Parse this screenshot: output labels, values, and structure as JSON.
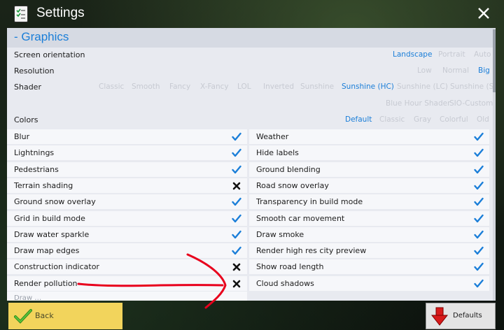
{
  "window": {
    "title": "Settings"
  },
  "section": {
    "title": "- Graphics"
  },
  "settings": [
    {
      "label": "Screen orientation",
      "options": [
        "Landscape",
        "Portrait",
        "Auto"
      ],
      "selected": "Landscape"
    },
    {
      "label": "Resolution",
      "options": [
        "Low",
        "Normal",
        "Big"
      ],
      "selected": "Big"
    },
    {
      "label": "Shader",
      "options": [
        "Classic",
        "Smooth",
        "Fancy",
        "X-Fancy",
        "LOL",
        "Inverted",
        "Sunshine",
        "Sunshine (HC)",
        "Sunshine (LC)",
        "Sunshine (S)",
        "Blue Hour Shader",
        "SIO-Custom"
      ],
      "selected": "Sunshine (HC)"
    },
    {
      "label": "Colors",
      "options": [
        "Default",
        "Classic",
        "Gray",
        "Colorful",
        "Old"
      ],
      "selected": "Default"
    }
  ],
  "toggles_left": [
    {
      "label": "Blur",
      "state": "check"
    },
    {
      "label": "Lightnings",
      "state": "check"
    },
    {
      "label": "Pedestrians",
      "state": "check"
    },
    {
      "label": "Terrain shading",
      "state": "cross"
    },
    {
      "label": "Ground snow overlay",
      "state": "check"
    },
    {
      "label": "Grid in build mode",
      "state": "check"
    },
    {
      "label": "Draw water sparkle",
      "state": "check"
    },
    {
      "label": "Draw map edges",
      "state": "check"
    },
    {
      "label": "Construction indicator",
      "state": "cross"
    },
    {
      "label": "Render pollution",
      "state": "cross"
    }
  ],
  "toggles_right": [
    {
      "label": "Weather",
      "state": "check"
    },
    {
      "label": "Hide labels",
      "state": "check"
    },
    {
      "label": "Ground blending",
      "state": "check"
    },
    {
      "label": "Road snow overlay",
      "state": "check"
    },
    {
      "label": "Transparency in build mode",
      "state": "check"
    },
    {
      "label": "Smooth car movement",
      "state": "check"
    },
    {
      "label": "Draw smoke",
      "state": "check"
    },
    {
      "label": "Render high res city preview",
      "state": "check"
    },
    {
      "label": "Show road length",
      "state": "check"
    },
    {
      "label": "Cloud shadows",
      "state": "check"
    }
  ],
  "footer": {
    "back_label": "Back",
    "defaults_label": "Defaults"
  },
  "colors": {
    "accent": "#1a7ed8",
    "back_button": "#f2d45c",
    "annotation": "#e8001c"
  }
}
